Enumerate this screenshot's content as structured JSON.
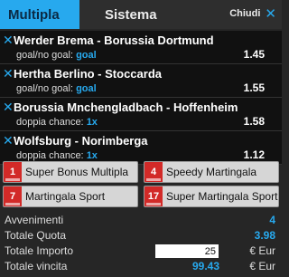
{
  "tabs": {
    "multipla": "Multipla",
    "sistema": "Sistema",
    "close_all": "Chiudi"
  },
  "bets": [
    {
      "event": "Werder Brema - Borussia Dortmund",
      "market_label": "goal/no goal:",
      "selection": "goal",
      "odd": "1.45"
    },
    {
      "event": "Hertha Berlino - Stoccarda",
      "market_label": "goal/no goal:",
      "selection": "goal",
      "odd": "1.55"
    },
    {
      "event": "Borussia Mnchengladbach - Hoffenheim",
      "market_label": "doppia chance:",
      "selection": "1x",
      "odd": "1.58"
    },
    {
      "event": "Wolfsburg - Norimberga",
      "market_label": "doppia chance:",
      "selection": "1x",
      "odd": "1.12"
    }
  ],
  "promos": [
    {
      "num": "1",
      "label": "Super Bonus Multipla"
    },
    {
      "num": "4",
      "label": "Speedy Martingala"
    },
    {
      "num": "7",
      "label": "Martingala Sport"
    },
    {
      "num": "17",
      "label": "Super Martingala Sport"
    }
  ],
  "summary": {
    "avvenimenti_label": "Avvenimenti",
    "avvenimenti_value": "4",
    "quota_label": "Totale Quota",
    "quota_value": "3.98",
    "importo_label": "Totale Importo",
    "importo_value": "25",
    "importo_unit": "€ Eur",
    "vincita_label": "Totale vincita",
    "vincita_value": "99.43",
    "vincita_unit": "€ Eur"
  },
  "colors": {
    "accent": "#27a9ee",
    "promo_icon": "#d22a28"
  }
}
